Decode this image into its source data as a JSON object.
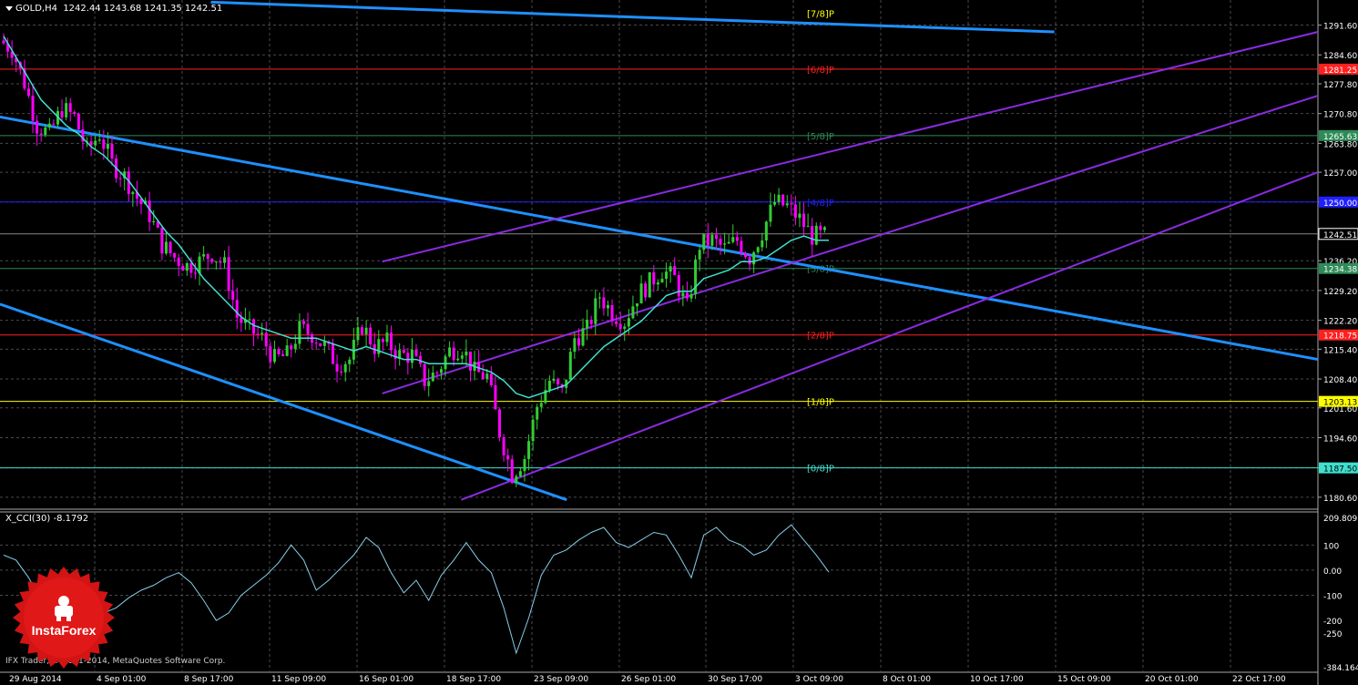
{
  "header": {
    "symbol": "GOLD,H4",
    "ohlc": "1242.44 1243.68 1241.35 1242.51"
  },
  "indicator": {
    "label": "X_CCI(30) -8.1792"
  },
  "footer": {
    "copyright": "IFX Trader, © 2001-2014, MetaQuotes Software Corp."
  },
  "logo": {
    "text": "InstaForex"
  },
  "colors": {
    "background": "#000000",
    "grid": "#4a4a4a",
    "bull": "#32cd32",
    "bear": "#ff00ff",
    "ma": "#40e0d0",
    "channel": "#1e90ff",
    "purple": "#8a2be2",
    "cci": "#87ceeb"
  },
  "price_axis": {
    "ticks": [
      "1291.60",
      "1284.60",
      "1277.80",
      "1270.80",
      "1263.80",
      "1257.00",
      "1250.00",
      "1242.51",
      "1236.20",
      "1229.20",
      "1222.20",
      "1215.40",
      "1208.40",
      "1201.60",
      "1194.60",
      "1187.50",
      "1180.60"
    ],
    "current_price": "1242.51"
  },
  "cci_axis": {
    "ticks": [
      "209.8091",
      "100",
      "0.00",
      "-100",
      "-200",
      "-250",
      "-384.1644"
    ]
  },
  "time_axis": {
    "ticks": [
      "29 Aug 2014",
      "4 Sep 01:00",
      "8 Sep 17:00",
      "11 Sep 09:00",
      "16 Sep 01:00",
      "18 Sep 17:00",
      "23 Sep 09:00",
      "26 Sep 01:00",
      "30 Sep 17:00",
      "3 Oct 09:00",
      "8 Oct 01:00",
      "10 Oct 17:00",
      "15 Oct 09:00",
      "20 Oct 01:00",
      "22 Oct 17:00"
    ]
  },
  "murrey_levels": [
    {
      "label": "[7/8]P",
      "price": "",
      "value": 1294.4,
      "color": "#ffff00"
    },
    {
      "label": "[6/8]P",
      "price": "1281.25",
      "value": 1281.25,
      "color": "#ff2020"
    },
    {
      "label": "[5/8]P",
      "price": "1265.63",
      "value": 1265.63,
      "color": "#2e8b57"
    },
    {
      "label": "[4/8]P",
      "price": "1250.00",
      "value": 1250.0,
      "color": "#2020ff"
    },
    {
      "label": "[3/8]P",
      "price": "1234.38",
      "value": 1234.38,
      "color": "#2e8b57"
    },
    {
      "label": "[2/8]P",
      "price": "1218.75",
      "value": 1218.75,
      "color": "#ff2020"
    },
    {
      "label": "[1/8]P",
      "price": "1203.13",
      "value": 1203.13,
      "color": "#ffff00"
    },
    {
      "label": "[0/8]P",
      "price": "1187.50",
      "value": 1187.5,
      "color": "#40e0d0"
    }
  ],
  "chart_data": {
    "type": "candlestick",
    "title": "GOLD,H4",
    "ylim": [
      1178.0,
      1297.5
    ],
    "x_categories": [
      "29 Aug 2014",
      "4 Sep 01:00",
      "8 Sep 17:00",
      "11 Sep 09:00",
      "16 Sep 01:00",
      "18 Sep 17:00",
      "23 Sep 09:00",
      "26 Sep 01:00",
      "30 Sep 17:00",
      "3 Oct 09:00",
      "8 Oct 01:00",
      "10 Oct 17:00",
      "15 Oct 09:00",
      "20 Oct 01:00",
      "22 Oct 17:00"
    ],
    "close_path": [
      1288,
      1286,
      1278,
      1268,
      1266,
      1272,
      1270,
      1262,
      1266,
      1259,
      1256,
      1251,
      1247,
      1240,
      1237,
      1235,
      1236,
      1238,
      1235,
      1223,
      1220,
      1218,
      1213,
      1214,
      1220,
      1219,
      1216,
      1212,
      1213,
      1221,
      1216,
      1217,
      1214,
      1214,
      1208,
      1210,
      1215,
      1216,
      1210,
      1209,
      1196,
      1186,
      1190,
      1202,
      1208,
      1205,
      1218,
      1220,
      1228,
      1224,
      1222,
      1228,
      1231,
      1234,
      1232,
      1225,
      1240,
      1241,
      1239,
      1241,
      1237,
      1243,
      1250,
      1249,
      1246,
      1242,
      1242
    ],
    "ma_path": [
      1289,
      1284,
      1279,
      1274,
      1271,
      1268,
      1266,
      1263,
      1261,
      1258,
      1255,
      1251,
      1247,
      1243,
      1240,
      1236,
      1232,
      1229,
      1226,
      1223,
      1221,
      1220,
      1219,
      1218,
      1218,
      1218,
      1217,
      1216,
      1215,
      1216,
      1215,
      1214,
      1213,
      1213,
      1212,
      1212,
      1212,
      1212,
      1211,
      1210,
      1208,
      1205,
      1204,
      1205,
      1206,
      1207,
      1210,
      1213,
      1216,
      1218,
      1220,
      1222,
      1225,
      1228,
      1229,
      1229,
      1232,
      1233,
      1234,
      1236,
      1236,
      1237,
      1239,
      1241,
      1242,
      1241,
      1241
    ],
    "cci": {
      "name": "X_CCI(30)",
      "ylim": [
        -384.1644,
        209.8091
      ],
      "ticks": [
        209.8091,
        100,
        0,
        -100,
        -200,
        -250,
        -384.1644
      ],
      "values": [
        60,
        40,
        -30,
        -120,
        -60,
        -30,
        -120,
        -200,
        -170,
        -150,
        -110,
        -80,
        -60,
        -30,
        -10,
        -50,
        -120,
        -200,
        -170,
        -100,
        -60,
        -20,
        30,
        100,
        40,
        -80,
        -40,
        10,
        60,
        130,
        90,
        -10,
        -90,
        -40,
        -120,
        -20,
        40,
        110,
        40,
        -10,
        -150,
        -330,
        -190,
        -20,
        60,
        80,
        120,
        150,
        170,
        110,
        90,
        120,
        150,
        140,
        60,
        -30,
        140,
        170,
        120,
        100,
        60,
        80,
        140,
        180,
        120,
        60,
        -8
      ]
    },
    "channels": {
      "descending_center": {
        "start": [
          0.0,
          1270.0
        ],
        "end": [
          1.0,
          1213.0
        ]
      },
      "descending_upper": {
        "start": [
          0.16,
          1297.0
        ],
        "end": [
          0.8,
          1290.0
        ]
      },
      "descending_lower": {
        "start": [
          0.0,
          1226.0
        ],
        "end": [
          0.43,
          1180.0
        ]
      },
      "ascending_lower": {
        "start": [
          0.35,
          1180.0
        ],
        "end": [
          1.0,
          1257.0
        ]
      },
      "ascending_center": {
        "start": [
          0.29,
          1205.0
        ],
        "end": [
          1.0,
          1275.0
        ]
      },
      "ascending_upper": {
        "start": [
          0.29,
          1236.0
        ],
        "end": [
          1.0,
          1290.0
        ]
      }
    }
  }
}
